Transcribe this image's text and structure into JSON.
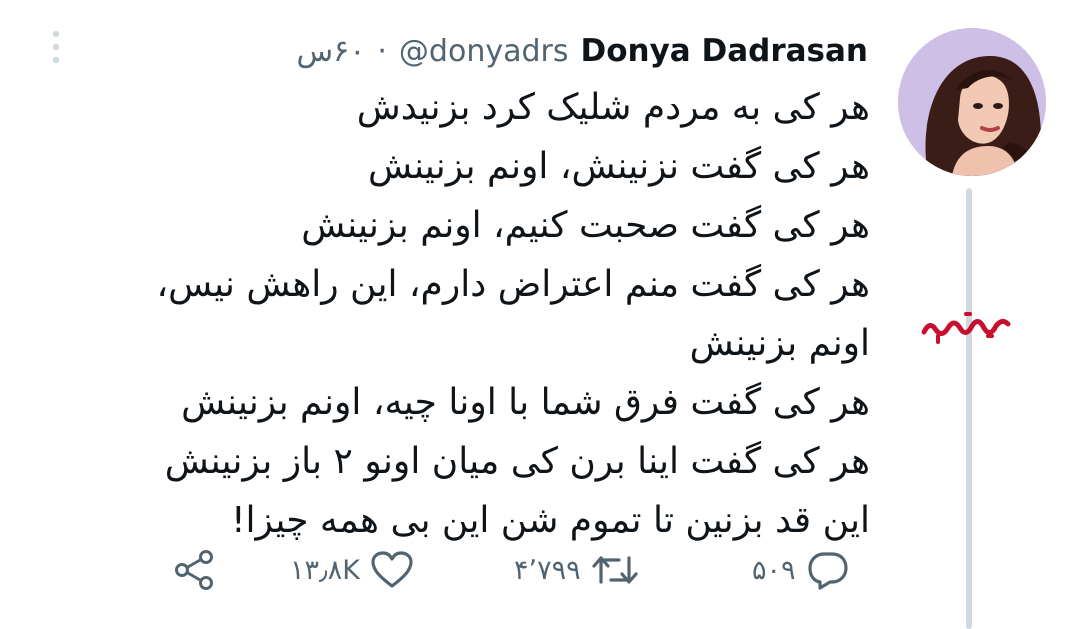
{
  "tweet": {
    "display_name": "Donya Dadrasan",
    "handle": "@donyadrs",
    "separator": "·",
    "time": "۶۰س",
    "lines": [
      "هر کی به مردم شلیک کرد بزنیدش",
      "هر کی گفت نزنینش، اونم بزنینش",
      "هر کی گفت صحبت کنیم، اونم بزنینش",
      "هر کی گفت منم اعتراض دارم، این راهش نیس، اونم بزنینش",
      "هر کی گفت فرق شما با اونا چیه، اونم بزنینش",
      "هر کی گفت اینا برن کی میان اونو ۲ باز بزنینش",
      "این قد بزنین تا تموم شن این بی همه چیزا!"
    ]
  },
  "actions": {
    "reply_count": "۵۰۹",
    "retweet_count": "۴٬۷۹۹",
    "like_count": "۱۳٫۸K"
  },
  "watermark": {
    "text": "بیدیوچ",
    "color": "#c8102e"
  },
  "icons": {
    "more": "more-vertical-icon",
    "reply": "reply-icon",
    "retweet": "retweet-icon",
    "like": "heart-icon",
    "share": "share-icon"
  },
  "colors": {
    "text": "#0f1419",
    "secondary": "#536471",
    "thread_line": "#cfd9de",
    "more_icon": "#cfd9de"
  }
}
